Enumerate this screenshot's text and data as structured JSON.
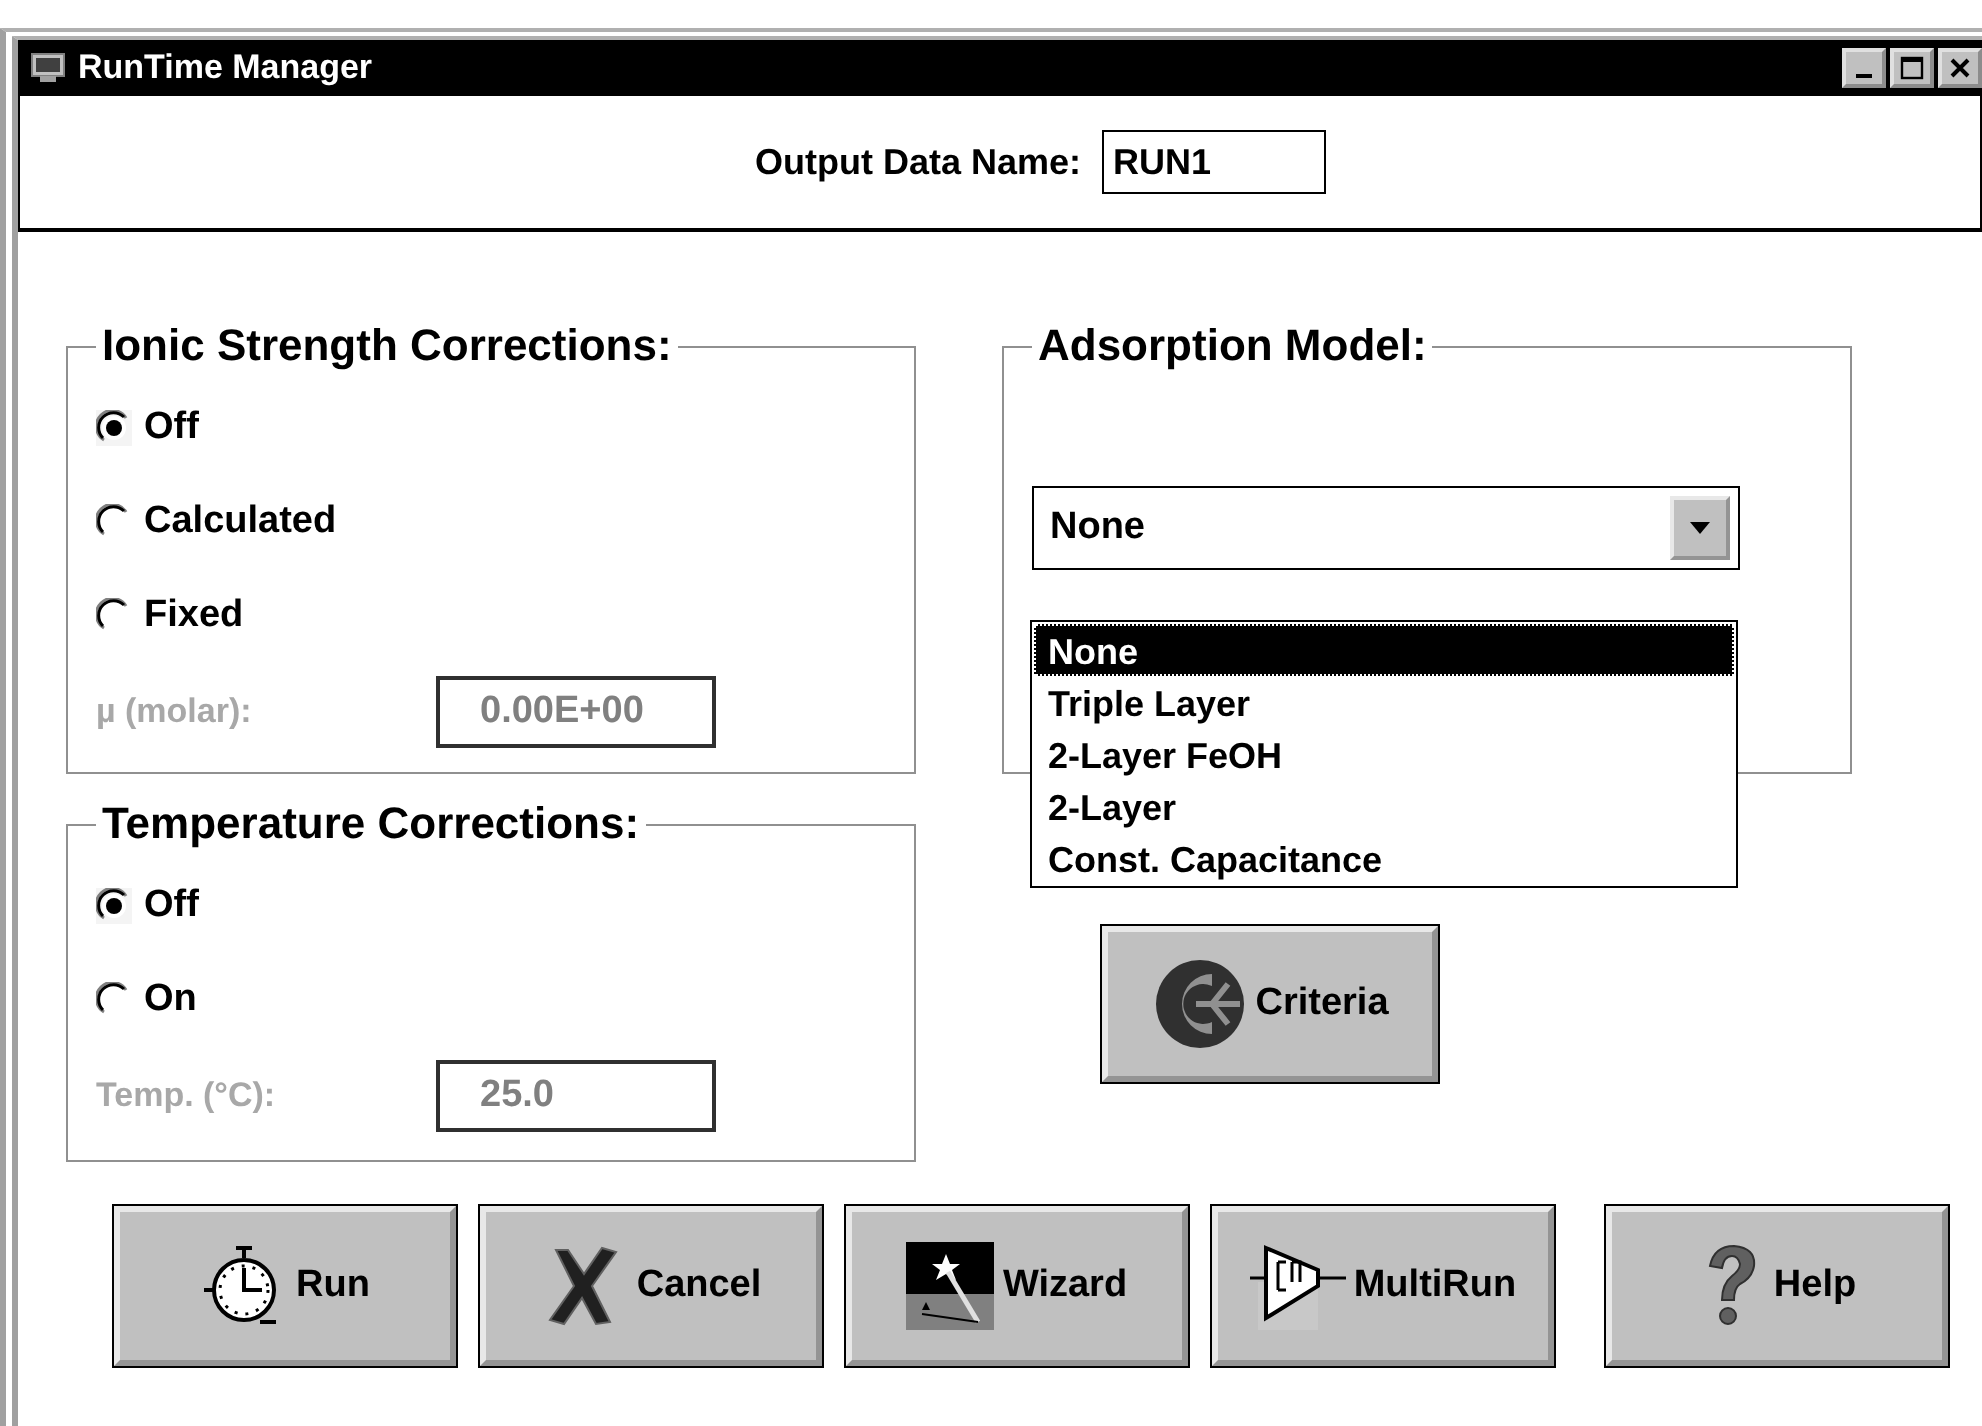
{
  "window": {
    "title": "RunTime Manager"
  },
  "header": {
    "label": "Output Data Name:",
    "value": "RUN1"
  },
  "ionic_strength": {
    "title": "Ionic Strength Corrections:",
    "options": [
      {
        "label": "Off",
        "selected": true
      },
      {
        "label": "Calculated",
        "selected": false
      },
      {
        "label": "Fixed",
        "selected": false
      }
    ],
    "field": {
      "label": "µ (molar):",
      "value": "0.00E+00",
      "disabled": true
    }
  },
  "temperature": {
    "title": "Temperature Corrections:",
    "options": [
      {
        "label": "Off",
        "selected": true
      },
      {
        "label": "On",
        "selected": false
      }
    ],
    "field": {
      "label": "Temp. (°C):",
      "value": "25.0",
      "disabled": true
    }
  },
  "adsorption": {
    "title": "Adsorption Model:",
    "value": "None",
    "expanded": true,
    "options": [
      {
        "label": "None",
        "selected": true
      },
      {
        "label": "Triple Layer",
        "selected": false
      },
      {
        "label": "2-Layer FeOH",
        "selected": false
      },
      {
        "label": "2-Layer",
        "selected": false
      },
      {
        "label": "Const. Capacitance",
        "selected": false
      }
    ]
  },
  "criteria_button": {
    "label": "Criteria"
  },
  "buttons": [
    {
      "label": "Run"
    },
    {
      "label": "Cancel"
    },
    {
      "label": "Wizard"
    },
    {
      "label": "MultiRun"
    },
    {
      "label": "Help"
    }
  ]
}
